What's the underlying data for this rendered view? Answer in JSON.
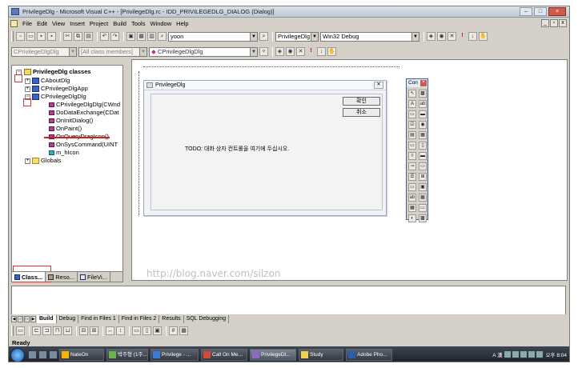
{
  "window": {
    "title": "PrivilegeDlg - Microsoft Visual C++ - [PrivilegeDlg.rc - IDD_PRIVILEGEDLG_DIALOG (Dialog)]",
    "min": "–",
    "max": "□",
    "close": "×"
  },
  "menu": [
    "File",
    "Edit",
    "View",
    "Insert",
    "Project",
    "Build",
    "Tools",
    "Window",
    "Help"
  ],
  "mdi": {
    "min": "_",
    "restore": "▫",
    "close": "x"
  },
  "toolbar1": {
    "find_value": "yoon",
    "project_combo": "PrivilegeDlg",
    "config_combo": "Win32 Debug"
  },
  "toolbar2": {
    "class_combo": "CPrivilegeDlgDlg",
    "filter_combo": "[All class members]",
    "member_combo": "CPrivilegeDlgDlg"
  },
  "tree": {
    "root": "PrivilegeDlg classes",
    "items": [
      "CAboutDlg",
      "CPrivilegeDlgApp",
      "CPrivilegeDlgDlg",
      "CPrivilegeDlgDlg(CWnd",
      "DoDataExchange(CDat",
      "OnInitDialog()",
      "OnPaint()",
      "OnQueryDragIcon()",
      "OnSysCommand(UINT",
      "m_hIcon",
      "Globals"
    ]
  },
  "workspace_tabs": [
    "Class...",
    "Reso...",
    "FileVi..."
  ],
  "dialog": {
    "title": "PrivilegeDlg",
    "ok_label": "확인",
    "cancel_label": "취소",
    "todo_text": "TODO: 대화 상자 컨트롤을 여기에 두십시오."
  },
  "controls_title": "Con",
  "watermark": "http://blog.naver.com/silzon",
  "output_tabs": [
    "Build",
    "Debug",
    "Find in Files 1",
    "Find in Files 2",
    "Results",
    "SQL Debugging"
  ],
  "status": "Ready",
  "taskbar": {
    "tasks": [
      "NateOn",
      "박주형 (1주...",
      "Privilege - ...",
      "Call On Me...",
      "PrivilegeDl...",
      "Study",
      "Adobe Pho..."
    ],
    "tray_lang": "A 漢",
    "clock": "오후 8:04"
  }
}
